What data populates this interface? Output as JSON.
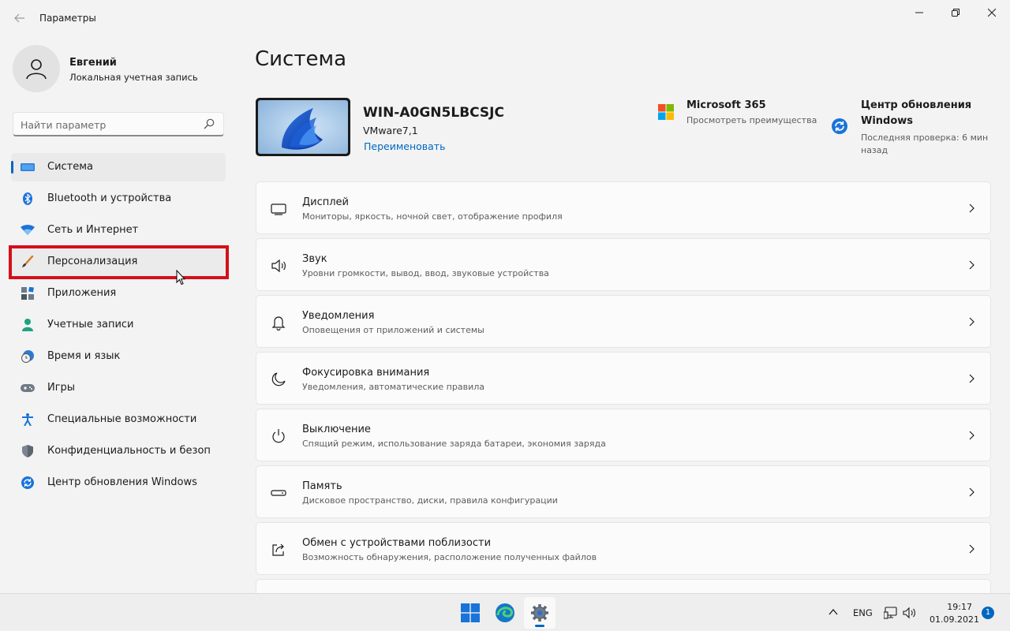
{
  "window": {
    "title": "Параметры",
    "back_icon": "arrow-left-icon"
  },
  "profile": {
    "name": "Евгений",
    "subtitle": "Локальная учетная запись"
  },
  "search": {
    "placeholder": "Найти параметр"
  },
  "sidebar": {
    "items": [
      {
        "label": "Система",
        "icon": "display-icon",
        "selected": true
      },
      {
        "label": "Bluetooth и устройства",
        "icon": "bluetooth-icon"
      },
      {
        "label": "Сеть и Интернет",
        "icon": "wifi-icon"
      },
      {
        "label": "Персонализация",
        "icon": "brush-icon",
        "hovered": true,
        "highlighted": true
      },
      {
        "label": "Приложения",
        "icon": "apps-icon"
      },
      {
        "label": "Учетные записи",
        "icon": "person-icon"
      },
      {
        "label": "Время и язык",
        "icon": "clock-globe-icon"
      },
      {
        "label": "Игры",
        "icon": "gamepad-icon"
      },
      {
        "label": "Специальные возможности",
        "icon": "accessibility-icon"
      },
      {
        "label": "Конфиденциальность и безопас",
        "icon": "shield-icon"
      },
      {
        "label": "Центр обновления Windows",
        "icon": "update-icon"
      }
    ]
  },
  "main": {
    "title": "Система",
    "device": {
      "name": "WIN-A0GN5LBCSJC",
      "model": "VMware7,1",
      "rename_label": "Переименовать"
    },
    "promos": [
      {
        "title": "Microsoft 365",
        "subtitle": "Просмотреть преимущества",
        "icon": "microsoft-logo-icon"
      },
      {
        "title": "Центр обновления Windows",
        "subtitle": "Последняя проверка: 6 мин назад",
        "icon": "update-icon"
      }
    ],
    "cards": [
      {
        "title": "Дисплей",
        "subtitle": "Мониторы, яркость, ночной свет, отображение профиля",
        "icon": "monitor-icon"
      },
      {
        "title": "Звук",
        "subtitle": "Уровни громкости, вывод, ввод, звуковые устройства",
        "icon": "speaker-icon"
      },
      {
        "title": "Уведомления",
        "subtitle": "Оповещения от приложений и системы",
        "icon": "bell-icon"
      },
      {
        "title": "Фокусировка внимания",
        "subtitle": "Уведомления, автоматические правила",
        "icon": "moon-icon"
      },
      {
        "title": "Выключение",
        "subtitle": "Спящий режим, использование заряда батареи, экономия заряда",
        "icon": "power-icon"
      },
      {
        "title": "Память",
        "subtitle": "Дисковое пространство, диски, правила конфигурации",
        "icon": "storage-icon"
      },
      {
        "title": "Обмен с устройствами поблизости",
        "subtitle": "Возможность обнаружения, расположение полученных файлов",
        "icon": "share-icon"
      }
    ]
  },
  "taskbar": {
    "apps": [
      {
        "name": "start",
        "icon": "windows-start-icon"
      },
      {
        "name": "edge",
        "icon": "edge-icon"
      },
      {
        "name": "settings",
        "icon": "settings-gear-icon",
        "active": true
      }
    ],
    "language": "ENG",
    "time": "19:17",
    "date": "01.09.2021",
    "notification_count": "1"
  },
  "colors": {
    "accent": "#0067c0",
    "highlight_box": "#d50f1a",
    "background": "#f3f3f3"
  }
}
